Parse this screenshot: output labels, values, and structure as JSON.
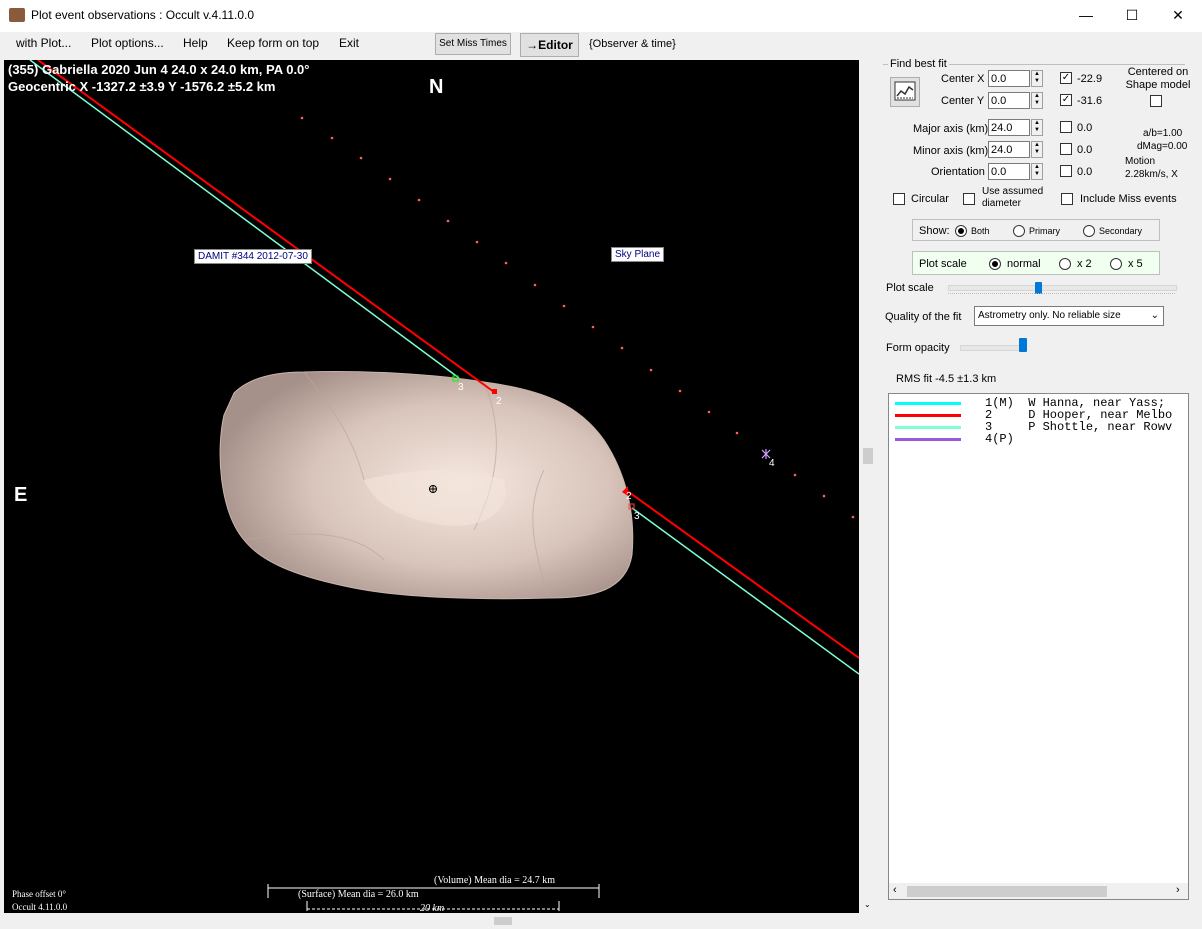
{
  "window": {
    "title": "Plot event observations : Occult v.4.11.0.0",
    "minimize": "—",
    "maximize": "☐",
    "close": "✕"
  },
  "menu": {
    "items": [
      "with Plot...",
      "Plot options...",
      "Help",
      "Keep form on top",
      "Exit"
    ],
    "set_miss_times": "Set Miss Times",
    "editor": "→Editor",
    "observer_time": "{Observer & time}"
  },
  "plot": {
    "header_line1": "(355) Gabriella  2020 Jun 4   24.0 x 24.0 km, PA 0.0°",
    "header_line2": "Geocentric  X  -1327.2 ±3.9  Y -1576.2 ±5.2 km",
    "north": "N",
    "east": "E",
    "damit_label": "DAMIT #344 2012-07-30",
    "sky_plane_label": "Sky Plane",
    "chord_labels": [
      "3",
      "2",
      "2",
      "3",
      "4"
    ],
    "volume_dia": "(Volume) Mean dia = 24.7 km",
    "surface_dia": "(Surface) Mean dia = 26.0 km",
    "scale_bar": "20 km",
    "phase_offset": "Phase offset 0°",
    "version": "Occult 4.11.0.0",
    "colors": {
      "chord1": "#00ffff",
      "chord2": "#ff0000",
      "chord3": "#7fffd4",
      "chord4": "#9b59d6",
      "background": "#000000"
    }
  },
  "panel": {
    "find_best_fit": "Find best fit",
    "center_x_label": "Center X",
    "center_x_value": "0.0",
    "center_x_result": "-22.9",
    "center_y_label": "Center Y",
    "center_y_value": "0.0",
    "center_y_result": "-31.6",
    "centered_on_shape_model": "Centered on Shape model",
    "major_axis_label": "Major axis (km)",
    "major_axis_value": "24.0",
    "major_axis_result": "0.0",
    "minor_axis_label": "Minor axis (km)",
    "minor_axis_value": "24.0",
    "minor_axis_result": "0.0",
    "orientation_label": "Orientation",
    "orientation_value": "0.0",
    "orientation_result": "0.0",
    "ab_ratio": "a/b=1.00",
    "dmag": "dMag=0.00",
    "motion_label": "Motion",
    "motion_value": "2.28km/s, X",
    "circular": "Circular",
    "use_assumed_diameter": "Use assumed diameter",
    "include_miss_events": "Include Miss events",
    "show_label": "Show:",
    "show_options": [
      "Both",
      "Primary",
      "Secondary"
    ],
    "show_selected": "Both",
    "plot_scale_group": "Plot scale",
    "scale_options": [
      "normal",
      "x 2",
      "x 5"
    ],
    "scale_selected": "normal",
    "plot_scale_slider_label": "Plot scale",
    "quality_label": "Quality of the fit",
    "quality_value": "Astrometry only. No reliable size",
    "form_opacity_label": "Form opacity",
    "rms_fit": "RMS fit -4.5 ±1.3 km",
    "observers": [
      {
        "text": "1(M)  W Hanna, near Yass;",
        "color": "#00ffff"
      },
      {
        "text": "2     D Hooper, near Melbo",
        "color": "#ff0000"
      },
      {
        "text": "3     P Shottle, near Rowv",
        "color": "#7fffd4"
      },
      {
        "text": "4(P)",
        "color": "#9b59d6"
      }
    ]
  }
}
